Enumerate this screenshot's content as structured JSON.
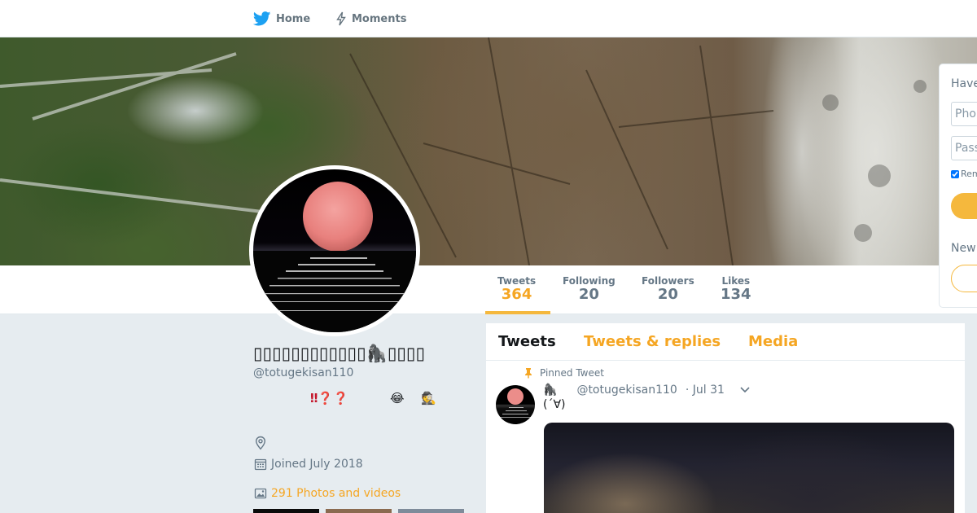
{
  "nav": {
    "home_label": "Home",
    "moments_label": "Moments"
  },
  "profile": {
    "display_name": "▯▯▯▯▯▯▯▯▯▯▯▯🦍▯▯▯▯",
    "screen_name": "@totugekisan110",
    "bio": "‼❓❓",
    "bio_emoji_1": "😂",
    "bio_emoji_2": "🕵",
    "joined": "Joined July 2018",
    "photos_videos": "291 Photos and videos"
  },
  "stats": [
    {
      "label": "Tweets",
      "value": "364"
    },
    {
      "label": "Following",
      "value": "20"
    },
    {
      "label": "Followers",
      "value": "20"
    },
    {
      "label": "Likes",
      "value": "134"
    }
  ],
  "tabs": {
    "tweets": "Tweets",
    "replies": "Tweets & replies",
    "media": "Media"
  },
  "tweet": {
    "pinned_label": "Pinned Tweet",
    "name_emoji": "🦍",
    "username": "@totugekisan110",
    "date": "· Jul 31",
    "text": "(´∀)"
  },
  "login": {
    "heading": "Have",
    "phone_placeholder": "Pho",
    "password_placeholder": "Pass",
    "remember": "Rem",
    "new_text": "New"
  },
  "colors": {
    "accent": "#f5a623",
    "twitter_blue": "#1da1f2"
  }
}
